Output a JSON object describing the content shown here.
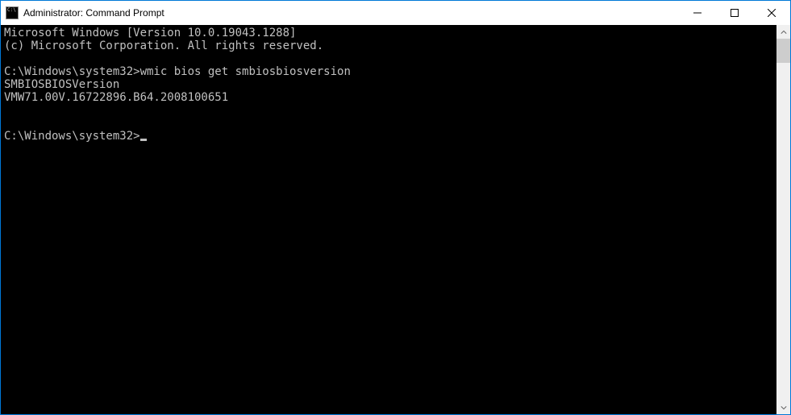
{
  "window": {
    "title": "Administrator: Command Prompt"
  },
  "terminal": {
    "header1": "Microsoft Windows [Version 10.0.19043.1288]",
    "header2": "(c) Microsoft Corporation. All rights reserved.",
    "prompt1": "C:\\Windows\\system32>",
    "command1": "wmic bios get smbiosbiosversion",
    "output1": "SMBIOSBIOSVersion",
    "output2": "VMW71.00V.16722896.B64.2008100651",
    "prompt2": "C:\\Windows\\system32>"
  }
}
